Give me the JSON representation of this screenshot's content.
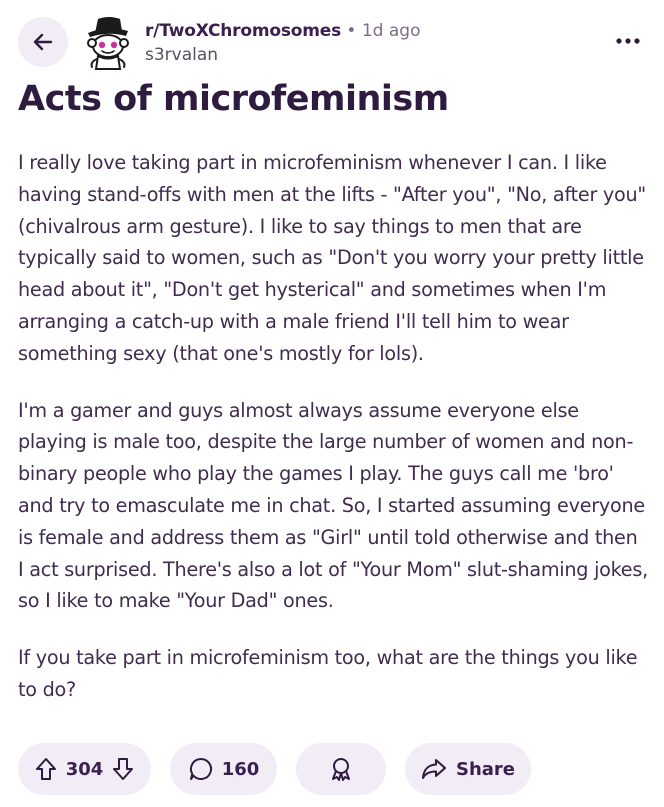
{
  "header": {
    "subreddit": "r/TwoXChromosomes",
    "separator": "•",
    "time": "1d ago",
    "author": "s3rvalan"
  },
  "post": {
    "title": "Acts of microfeminism",
    "paragraphs": [
      "I really love taking part in microfeminism whenever I can. I like having stand-offs with men at the lifts - \"After you\", \"No, after you\" (chivalrous arm gesture). I like to say things to men that are typically said to women, such as \"Don't you worry your pretty little head about it\", \"Don't get hysterical\" and sometimes when I'm arranging a catch-up with a male friend I'll tell him to wear something sexy (that one's mostly for lols).",
      "I'm a gamer and guys almost always assume everyone else playing is male too, despite the large number of women and non-binary people who play the games I play. The guys call me 'bro' and try to emasculate me in chat. So, I started assuming everyone is female and address them as \"Girl\" until told otherwise and then I act surprised. There's also a lot of \"Your Mom\" slut-shaming jokes, so I like to make \"Your Dad\" ones.",
      "If you take part in microfeminism too, what are the things you like to do?"
    ]
  },
  "actions": {
    "votes": "304",
    "comments": "160",
    "share_label": "Share"
  },
  "icons": {
    "back": "arrow-left-icon",
    "more": "more-horizontal-icon",
    "upvote": "arrow-up-icon",
    "downvote": "arrow-down-icon",
    "comment": "comment-bubble-icon",
    "award": "award-ribbon-icon",
    "share": "share-arrow-icon"
  },
  "colors": {
    "text": "#3f2c4f",
    "title": "#2f1b3f",
    "pill_background": "#f1ecf5",
    "muted": "#7b6e86"
  }
}
